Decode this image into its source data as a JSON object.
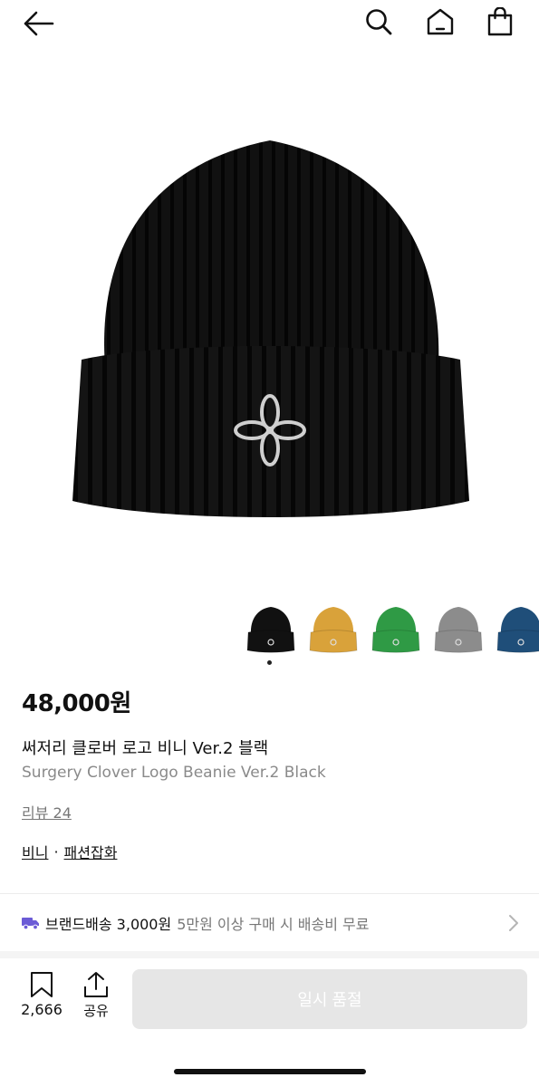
{
  "header": {
    "back_icon": "arrow-left-icon",
    "search_icon": "search-icon",
    "home_icon": "home-icon",
    "bag_icon": "shopping-bag-icon"
  },
  "product": {
    "price": "48,000원",
    "title_ko": "써저리 클로버 로고 비니 Ver.2 블랙",
    "title_en": "Surgery Clover Logo Beanie Ver.2 Black",
    "review_link": "리뷰 24",
    "category_primary": "비니",
    "category_separator": "·",
    "category_secondary": "패션잡화"
  },
  "color_options": [
    {
      "name": "black",
      "color": "#111111"
    },
    {
      "name": "mustard",
      "color": "#d9a23a"
    },
    {
      "name": "green",
      "color": "#2f9a45"
    },
    {
      "name": "gray",
      "color": "#8c8c8c"
    },
    {
      "name": "navy",
      "color": "#1f4e79"
    }
  ],
  "gallery": {
    "selected_index": 0
  },
  "shipping": {
    "icon": "truck-icon",
    "icon_color": "#6b5bd6",
    "main_text": "브랜드배송 3,000원",
    "sub_text": "5만원 이상 구매 시 배송비 무료",
    "chevron_icon": "chevron-right-icon"
  },
  "actions": {
    "wish_icon": "bookmark-icon",
    "wish_count": "2,666",
    "share_icon": "share-icon",
    "share_label": "공유",
    "soldout_label": "일시 품절"
  }
}
